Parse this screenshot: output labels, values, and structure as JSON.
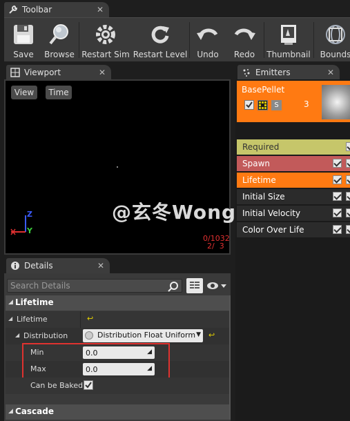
{
  "toolbar_tab": {
    "title": "Toolbar",
    "close": "✕"
  },
  "toolbar": {
    "buttons": [
      {
        "label": "Save",
        "icon": "save-icon"
      },
      {
        "label": "Browse",
        "icon": "browse-icon"
      },
      {
        "label": "Restart Sim",
        "icon": "restart-sim-icon"
      },
      {
        "label": "Restart Level",
        "icon": "restart-level-icon"
      },
      {
        "label": "Undo",
        "icon": "undo-icon"
      },
      {
        "label": "Redo",
        "icon": "redo-icon"
      },
      {
        "label": "Thumbnail",
        "icon": "thumbnail-icon"
      },
      {
        "label": "Bounds",
        "icon": "bounds-icon"
      }
    ]
  },
  "viewport": {
    "tab_title": "Viewport",
    "close": "✕",
    "view_button": "View",
    "time_button": "Time",
    "stats_line1": "0/1032",
    "stats_line2": "2/  3",
    "axis_z": "Z",
    "axis_y": "Y"
  },
  "watermark": "@玄冬Wong",
  "emitters": {
    "tab_title": "Emitters",
    "close": "✕",
    "emitter_name": "BasePellet",
    "emitter_count": "3",
    "solo_label": "S",
    "modules": [
      {
        "label": "Required",
        "color": "#c6c66a",
        "text_color": "#333333"
      },
      {
        "label": "Spawn",
        "color": "#c25a5a",
        "text_color": "#ffffff"
      },
      {
        "label": "Lifetime",
        "color": "#ff7a12",
        "text_color": "#ffffff"
      },
      {
        "label": "Initial Size",
        "color": "#2b2b2b",
        "text_color": "#ffffff"
      },
      {
        "label": "Initial Velocity",
        "color": "#2b2b2b",
        "text_color": "#ffffff"
      },
      {
        "label": "Color Over Life",
        "color": "#2b2b2b",
        "text_color": "#ffffff"
      }
    ]
  },
  "details": {
    "tab_title": "Details",
    "close": "✕",
    "search_placeholder": "Search Details",
    "section_lifetime": "Lifetime",
    "prop_lifetime": "Lifetime",
    "prop_distribution": "Distribution",
    "distribution_value": "Distribution Float Uniform",
    "prop_min": "Min",
    "min_value": "0.0",
    "prop_max": "Max",
    "max_value": "0.0",
    "prop_can_be_baked": "Can be Baked",
    "section_cascade": "Cascade",
    "reset_glyph": "↩"
  },
  "colors": {
    "accent_orange": "#ff7a12",
    "highlight_red": "#e0322f"
  }
}
